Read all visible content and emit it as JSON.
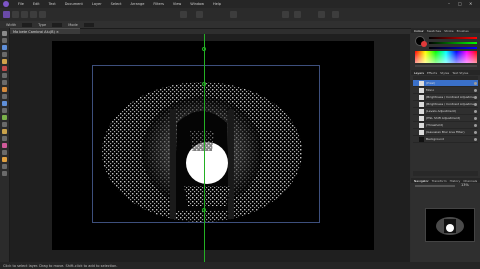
{
  "menubar": {
    "items": [
      "File",
      "Edit",
      "Text",
      "Document",
      "Layer",
      "Select",
      "Arrange",
      "Filters",
      "View",
      "Window",
      "Help"
    ]
  },
  "document": {
    "tab_title": "Ma bete Cambrai Alu(B) ×"
  },
  "contextbar": {
    "items": [
      "Width",
      "Type",
      "Mode"
    ]
  },
  "panels": {
    "color_tabs": [
      "Colour",
      "Swatches",
      "Stroke",
      "Brushes"
    ],
    "layers_tabs": [
      "Layers",
      "Effects",
      "Styles",
      "Text Styles"
    ],
    "layers": [
      {
        "name": "(Pixel)"
      },
      {
        "name": "Mono"
      },
      {
        "name": "(Brightness / Contrast Adjustment)"
      },
      {
        "name": "(Brightness / Contrast Adjustment)"
      },
      {
        "name": "(Levels Adjustment)"
      },
      {
        "name": "(HSL Shift Adjustment)"
      },
      {
        "name": "(Threshold)"
      },
      {
        "name": "(Gaussian Blur Live Filter)"
      },
      {
        "name": "Background"
      }
    ],
    "navigator_tabs": [
      "Navigator",
      "Transform",
      "History",
      "Channels"
    ],
    "zoom": "13%"
  },
  "statusbar": {
    "text": "Click to select layer. Drag to move. Shift-click to add to selection."
  },
  "colors": {
    "accent": "#7d55c7",
    "guide": "#23b023",
    "selection": "#3a70c9"
  }
}
